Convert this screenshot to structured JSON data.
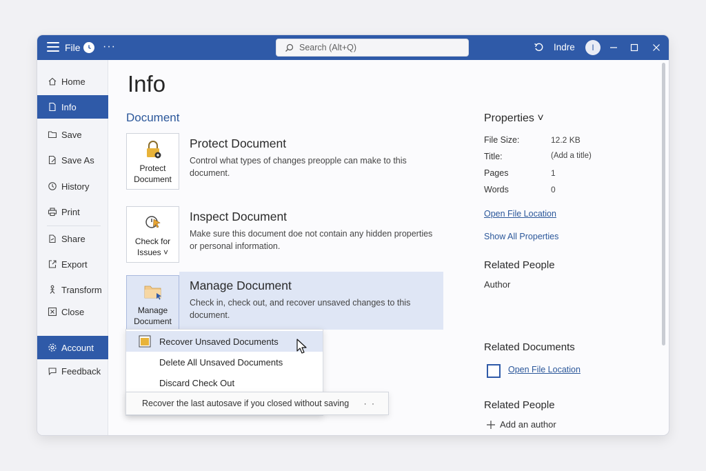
{
  "titlebar": {
    "file_label": "File",
    "more_label": "···",
    "search_placeholder": "Search (Alt+Q)",
    "user_name": "Indre",
    "avatar_initial": "I"
  },
  "sidebar": {
    "items": [
      {
        "label": "Home",
        "icon": "home-icon"
      },
      {
        "label": "Info",
        "icon": "document-icon",
        "active": true
      },
      {
        "label": "Save",
        "icon": "folder-icon"
      },
      {
        "label": "Save As",
        "icon": "save-as-icon"
      },
      {
        "label": "History",
        "icon": "history-icon"
      },
      {
        "label": "Print",
        "icon": "printer-icon"
      },
      {
        "label": "Share",
        "icon": "share-icon"
      },
      {
        "label": "Export",
        "icon": "export-icon"
      },
      {
        "label": "Transform",
        "icon": "transform-icon"
      },
      {
        "label": "Close",
        "icon": "close-box-icon"
      },
      {
        "label": "Account",
        "icon": "gear-icon",
        "active": true
      },
      {
        "label": "Feedback",
        "icon": "feedback-icon"
      }
    ]
  },
  "main": {
    "title": "Info",
    "section": "Document",
    "protect": {
      "button_line1": "Protect",
      "button_line2": "Document",
      "title": "Protect Document",
      "description": "Control what types of changes preopple can make to this document."
    },
    "inspect": {
      "button_line1": "Check for",
      "button_line2": "Issues ˅",
      "title": "Inspect Document",
      "description": "Make sure this document doe not contain any hidden properties or personal information."
    },
    "manage": {
      "button_line1": "Manage",
      "button_line2": "Document",
      "title": "Manage Document",
      "description": "Check in, check out, and recover unsaved changes to this document."
    },
    "menu": {
      "items": [
        "Recover Unsaved Documents",
        "Delete All Unsaved Documents",
        "Discard Check Out"
      ],
      "tooltip": "Recover the last autosave if you closed without saving",
      "tooltip_dots": "· ·"
    }
  },
  "properties": {
    "header": "Properties ˅",
    "rows": [
      {
        "label": "File Size:",
        "value": "12.2 KB"
      },
      {
        "label": "Title:",
        "value": "(Add a title)"
      },
      {
        "label": "Pages",
        "value": "1"
      },
      {
        "label": "Words",
        "value": "0"
      }
    ],
    "open_file_location": "Open File Location",
    "show_all": "Show All Properties",
    "related_people": "Related People",
    "author_label": "Author",
    "related_documents": "Related Documents",
    "related_doc_link": "Open File Location",
    "related_people_2": "Related People",
    "add_author": "Add an author"
  },
  "colors": {
    "accent": "#2f5aa8",
    "highlight": "#dfe6f5",
    "link": "#2b579a"
  }
}
